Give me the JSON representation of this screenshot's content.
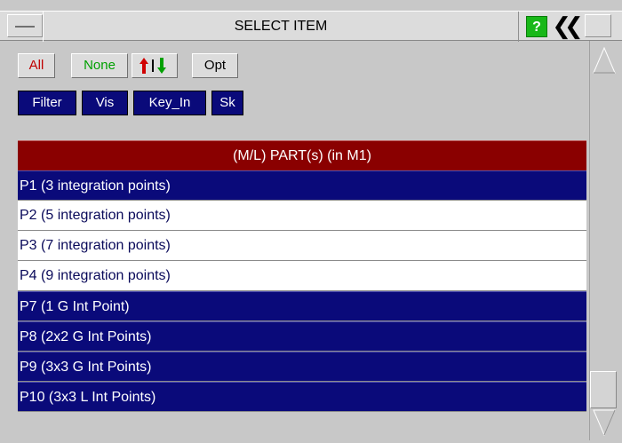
{
  "window": {
    "title": "SELECT ITEM",
    "help_label": "?",
    "collapse_label": "❮❮"
  },
  "toolbar": {
    "all_label": "All",
    "none_label": "None",
    "opt_label": "Opt",
    "filter_label": "Filter",
    "vis_label": "Vis",
    "key_in_label": "Key_In",
    "sk_label": "Sk"
  },
  "list": {
    "header": "(M/L) PART(s) (in M1)",
    "rows": [
      {
        "label": "P1 (3 integration points)",
        "selected": true
      },
      {
        "label": "P2 (5 integration points)",
        "selected": false
      },
      {
        "label": "P3 (7 integration points)",
        "selected": false
      },
      {
        "label": "P4 (9 integration points)",
        "selected": false
      },
      {
        "label": "P7 (1 G Int Point)",
        "selected": true
      },
      {
        "label": "P8 (2x2 G Int Points)",
        "selected": true
      },
      {
        "label": "P9 (3x3 G Int Points)",
        "selected": true
      },
      {
        "label": "P10 (3x3 L Int Points)",
        "selected": true
      }
    ]
  },
  "colors": {
    "selected_bg": "#0a0a7a",
    "header_bg": "#8a0000",
    "panel_bg": "#c8c8c8"
  },
  "icons": {
    "minimize": "minimize-icon",
    "help": "help-icon",
    "collapse": "double-chevron-left-icon",
    "sort": "sort-up-down-icon",
    "scroll_up": "triangle-up-icon",
    "scroll_down": "triangle-down-icon"
  }
}
